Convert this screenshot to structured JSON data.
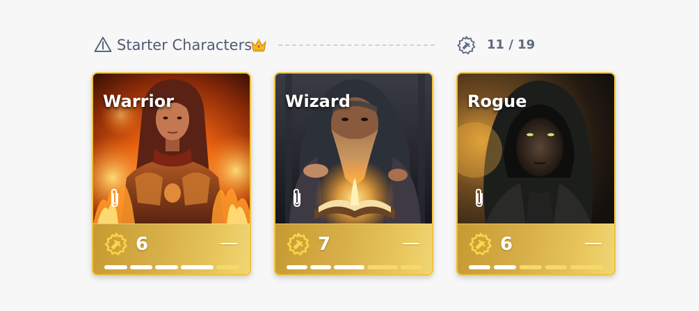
{
  "header": {
    "title": "Starter Characters",
    "progress": "11 / 19",
    "warning_icon": "warning-triangle-icon",
    "badge_icon": "crown-icon",
    "progress_icon": "gear-icon"
  },
  "colors": {
    "card_border": "#efc23a",
    "footer_gold": "#d8b04a",
    "segment_filled": "#ffffff",
    "segment_empty": "#f7d96a",
    "title_text": "#505a72"
  },
  "cards": [
    {
      "name": "Warrior",
      "value": "6",
      "segments_filled": 4,
      "segments_total": 5,
      "attachment_icon": "paperclip-icon"
    },
    {
      "name": "Wizard",
      "value": "7",
      "segments_filled": 3,
      "segments_total": 5,
      "attachment_icon": "paperclip-icon"
    },
    {
      "name": "Rogue",
      "value": "6",
      "segments_filled": 2,
      "segments_total": 5,
      "attachment_icon": "paperclip-icon"
    }
  ]
}
